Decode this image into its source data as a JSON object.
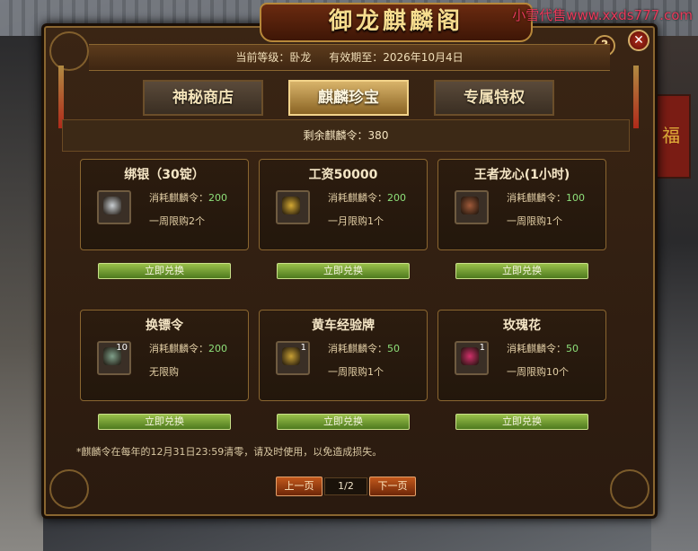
{
  "watermark": "小雪代售www.xxds777.com",
  "title": "御龙麒麟阁",
  "controls": {
    "help_label": "?",
    "close_label": "✕"
  },
  "status": {
    "level": "当前等级：卧龙",
    "expire": "有效期至：2026年10月4日"
  },
  "tabs": [
    {
      "label": "神秘商店",
      "active": false
    },
    {
      "label": "麒麟珍宝",
      "active": true
    },
    {
      "label": "专属特权",
      "active": false
    }
  ],
  "remaining": "剩余麒麟令：380",
  "redeem_label": "立即兑换",
  "items": [
    {
      "name": "绑银（30锭）",
      "cost_label": "消耗麒麟令：",
      "cost": "200",
      "limit": "一周限购2个",
      "icon": "silver-ingot-icon",
      "icon_color": "#c9ced2",
      "qty": ""
    },
    {
      "name": "工资50000",
      "cost_label": "消耗麒麟令：",
      "cost": "200",
      "limit": "一月限购1个",
      "icon": "gold-coins-icon",
      "icon_color": "#d4a933",
      "qty": ""
    },
    {
      "name": "王者龙心(1小时)",
      "cost_label": "消耗麒麟令：",
      "cost": "100",
      "limit": "一周限购1个",
      "icon": "dragon-heart-icon",
      "icon_color": "#a05a3a",
      "qty": ""
    },
    {
      "name": "换镖令",
      "cost_label": "消耗麒麟令：",
      "cost": "200",
      "limit": "无限购",
      "icon": "escort-token-icon",
      "icon_color": "#7fa08a",
      "qty": "10"
    },
    {
      "name": "黄车经验牌",
      "cost_label": "消耗麒麟令：",
      "cost": "50",
      "limit": "一周限购1个",
      "icon": "yellow-cart-icon",
      "icon_color": "#c8a034",
      "qty": "1"
    },
    {
      "name": "玫瑰花",
      "cost_label": "消耗麒麟令：",
      "cost": "50",
      "limit": "一周限购10个",
      "icon": "rose-icon",
      "icon_color": "#d0306a",
      "qty": "1"
    }
  ],
  "note": "*麒麟令在每年的12月31日23:59清零，请及时使用，以免造成损失。",
  "pager": {
    "prev": "上一页",
    "page": "1/2",
    "next": "下一页"
  },
  "decor": {
    "lantern_char": "福"
  }
}
